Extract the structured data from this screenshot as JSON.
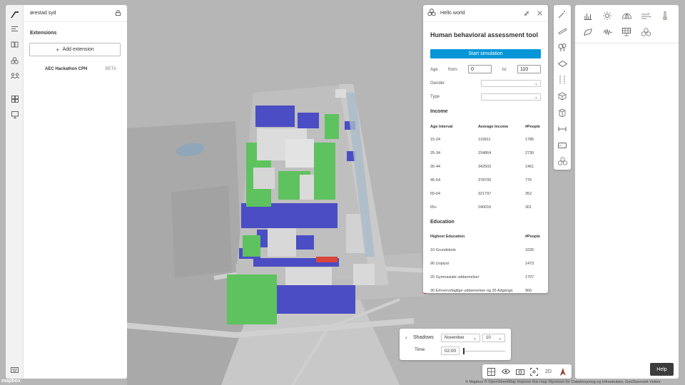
{
  "colors": {
    "accent": "#0696d7",
    "building_blue": "#4a4dc4",
    "park_green": "#5ec25e",
    "highlight_red": "#d9453b",
    "panel_bg": "#ffffff",
    "map_bg": "#b8b8b8"
  },
  "left_panel": {
    "project_name": "ørestad syd",
    "extensions_title": "Extensions",
    "add_extension_label": "Add extension",
    "extension": {
      "name": "AEC Hackathon CPH",
      "badge": "BETA"
    }
  },
  "left_rail_icons": [
    "logo-icon",
    "menu-icon",
    "book-icon",
    "analysis-icon",
    "people-icon",
    "grid-icon",
    "presentation-icon",
    "keyboard-icon"
  ],
  "hello_world": {
    "title": "Hello world",
    "heading": "Human behavioral assessment tool",
    "start_button": "Start simulation",
    "age_label": "Age",
    "from_label": "from:",
    "age_from": "0",
    "to_label": "to:",
    "age_to": "110",
    "gender_label": "Gender",
    "type_label": "Type",
    "income": {
      "title": "Income",
      "headers": [
        "Age Interval",
        "Average Income",
        "#People"
      ],
      "rows": [
        [
          "15-24",
          "119911",
          "1785"
        ],
        [
          "25-34",
          "234864",
          "2730"
        ],
        [
          "35-44",
          "342502",
          "1461"
        ],
        [
          "45-54",
          "378700",
          "776"
        ],
        [
          "55-64",
          "321797",
          "352"
        ],
        [
          "65+",
          "240016",
          "301"
        ]
      ]
    },
    "education": {
      "title": "Education",
      "headers": [
        "Highest Education",
        "#People"
      ],
      "rows": [
        [
          "10 Grundskole",
          "1026"
        ],
        [
          "90 Uoplyst",
          "1473"
        ],
        [
          "20 Gymnasiale uddannelser",
          "1707"
        ],
        [
          "30 Erhvervsfaglige uddannelser og 35 Adgangs",
          "906"
        ]
      ]
    }
  },
  "shadows": {
    "title": "Shadows",
    "month": "November",
    "day": "10",
    "time_label": "Time",
    "time_value": "02:00",
    "time_fraction": 0.0
  },
  "bottombar": {
    "mode_2d": "2D"
  },
  "help_label": "Help",
  "attribution": "© Mapbox © OpenStreetMap Improve this map Styrelsen for Dataforsyning og Infrastruktur, GeoDanmark Vektor",
  "mapbox_logo": "mapbox"
}
